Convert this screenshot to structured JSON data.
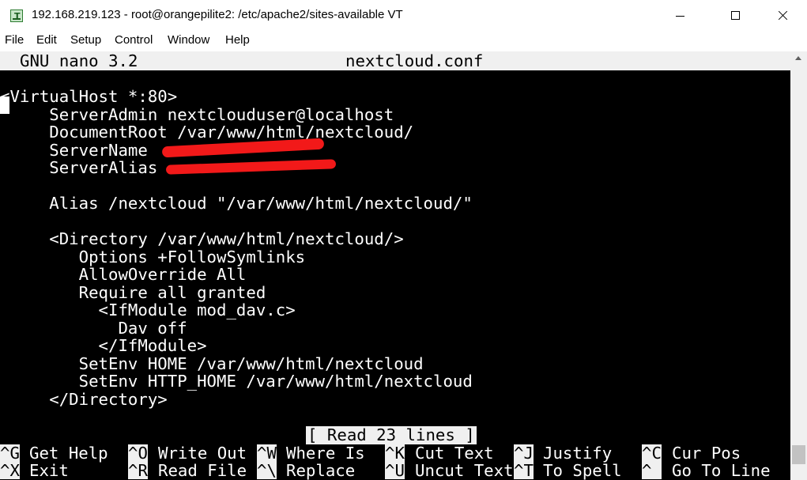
{
  "window": {
    "title": "192.168.219.123 - root@orangepilite2: /etc/apache2/sites-available VT",
    "icon": "terminal-app-icon"
  },
  "menu": [
    "File",
    "Edit",
    "Setup",
    "Control",
    "Window",
    "Help"
  ],
  "nano": {
    "version": "GNU nano 3.2",
    "filename": "nextcloud.conf"
  },
  "file_lines": [
    "<VirtualHost *:80>",
    "     ServerAdmin nextclouduser@localhost",
    "     DocumentRoot /var/www/html/nextcloud/",
    "     ServerName",
    "     ServerAlias",
    "",
    "     Alias /nextcloud \"/var/www/html/nextcloud/\"",
    "",
    "     <Directory /var/www/html/nextcloud/>",
    "        Options +FollowSymlinks",
    "        AllowOverride All",
    "        Require all granted",
    "          <IfModule mod_dav.c>",
    "            Dav off",
    "          </IfModule>",
    "        SetEnv HOME /var/www/html/nextcloud",
    "        SetEnv HTTP_HOME /var/www/html/nextcloud",
    "     </Directory>"
  ],
  "status_message": "[ Read 23 lines ]",
  "shortcuts": [
    [
      {
        "key": "^G",
        "label": "Get Help"
      },
      {
        "key": "^O",
        "label": "Write Out"
      },
      {
        "key": "^W",
        "label": "Where Is"
      },
      {
        "key": "^K",
        "label": "Cut Text"
      },
      {
        "key": "^J",
        "label": "Justify"
      },
      {
        "key": "^C",
        "label": "Cur Pos"
      }
    ],
    [
      {
        "key": "^X",
        "label": "Exit"
      },
      {
        "key": "^R",
        "label": "Read File"
      },
      {
        "key": "^\\",
        "label": "Replace"
      },
      {
        "key": "^U",
        "label": "Uncut Text"
      },
      {
        "key": "^T",
        "label": "To Spell"
      },
      {
        "key": "^_",
        "label": "Go To Line"
      }
    ]
  ]
}
